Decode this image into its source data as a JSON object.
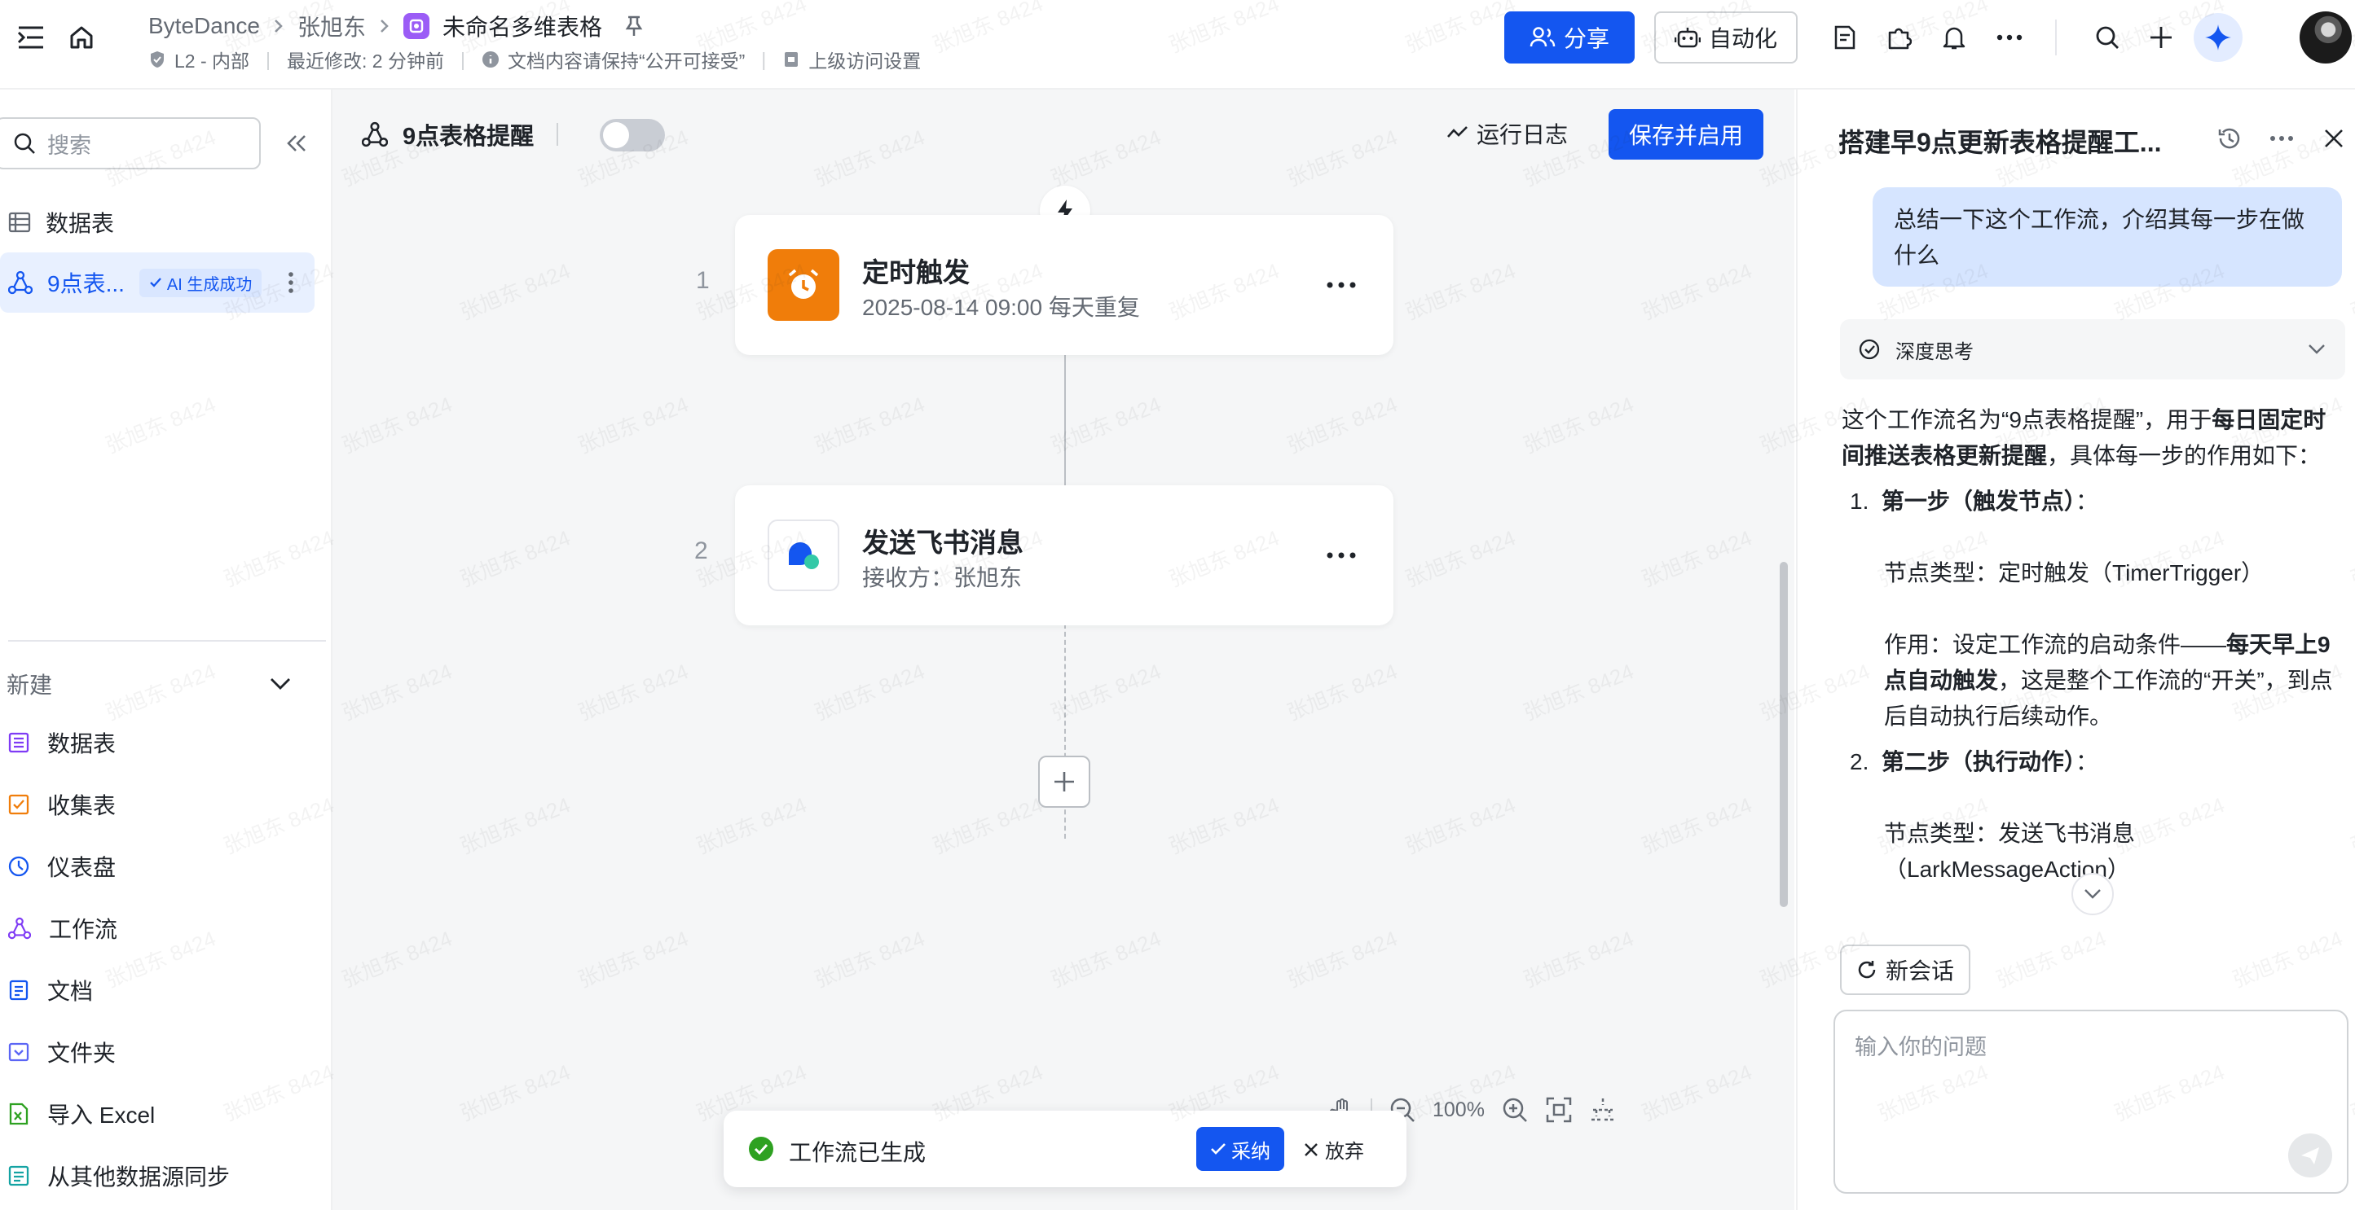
{
  "header": {
    "breadcrumb": [
      "ByteDance",
      "张旭东",
      "未命名多维表格"
    ],
    "security_level": "L2 - 内部",
    "last_modified": "最近修改: 2 分钟前",
    "doc_notice": "文档内容请保持“公开可接受”",
    "access_settings": "上级访问设置",
    "share_label": "分享",
    "automation_label": "自动化"
  },
  "sidebar": {
    "search_placeholder": "搜索",
    "items": [
      {
        "label": "数据表",
        "icon": "table-icon"
      },
      {
        "label": "9点表...",
        "icon": "workflow-icon",
        "badge": "AI 生成成功"
      }
    ],
    "new_section_label": "新建",
    "new_items": [
      {
        "label": "数据表",
        "icon": "table-icon",
        "color": "#7f3bf5"
      },
      {
        "label": "收集表",
        "icon": "form-icon",
        "color": "#f07d0a"
      },
      {
        "label": "仪表盘",
        "icon": "dashboard-icon",
        "color": "#1456f0"
      },
      {
        "label": "工作流",
        "icon": "workflow-icon",
        "color": "#7f3bf5"
      },
      {
        "label": "文档",
        "icon": "doc-icon",
        "color": "#1456f0"
      },
      {
        "label": "文件夹",
        "icon": "folder-icon",
        "color": "#5b65f5"
      },
      {
        "label": "导入 Excel",
        "icon": "excel-icon",
        "color": "#2ea121"
      },
      {
        "label": "从其他数据源同步",
        "icon": "sync-icon",
        "color": "#14a3a3"
      }
    ]
  },
  "workflow": {
    "title": "9点表格提醒",
    "enabled": false,
    "run_log_label": "运行日志",
    "save_label": "保存并启用",
    "nodes": [
      {
        "index": "1",
        "title": "定时触发",
        "subtitle": "2025-08-14 09:00 每天重复",
        "icon": "alarm-clock-icon",
        "color": "#f07d0a"
      },
      {
        "index": "2",
        "title": "发送飞书消息",
        "subtitle": "接收方：张旭东",
        "icon": "lark-message-icon",
        "color": "#1456f0"
      }
    ],
    "zoom": "100%",
    "toast": {
      "text": "工作流已生成",
      "adopt_label": "采纳",
      "discard_label": "放弃"
    }
  },
  "chat": {
    "title": "搭建早9点更新表格提醒工...",
    "user_message": "总结一下这个工作流，介绍其每一步在做什么",
    "think_label": "深度思考",
    "answer": {
      "intro_a": "这个工作流名为“9点表格提醒”，用于",
      "intro_bold": "每日固定时间推送表格更新提醒",
      "intro_b": "，具体每一步的作用如下：",
      "step1_title": "第一步（触发节点）",
      "step1_colon": "：",
      "step1_type": "节点类型：定时触发（TimerTrigger）",
      "step1_role_a": "作用：设定工作流的启动条件——",
      "step1_role_bold": "每天早上9点自动触发",
      "step1_role_b": "，这是整个工作流的“开关”，到点后自动执行后续动作。",
      "step2_title": "第二步（执行动作）",
      "step2_colon": "：",
      "step2_type_a": "节点类型：发送飞书消息",
      "step2_type_b": "（LarkMessageAction）"
    },
    "new_chat_label": "新会话",
    "input_placeholder": "输入你的问题"
  },
  "watermark": "张旭东 8424",
  "colors": {
    "primary": "#1456f0",
    "canvas_bg": "#f5f6f7",
    "success": "#2ea121"
  }
}
